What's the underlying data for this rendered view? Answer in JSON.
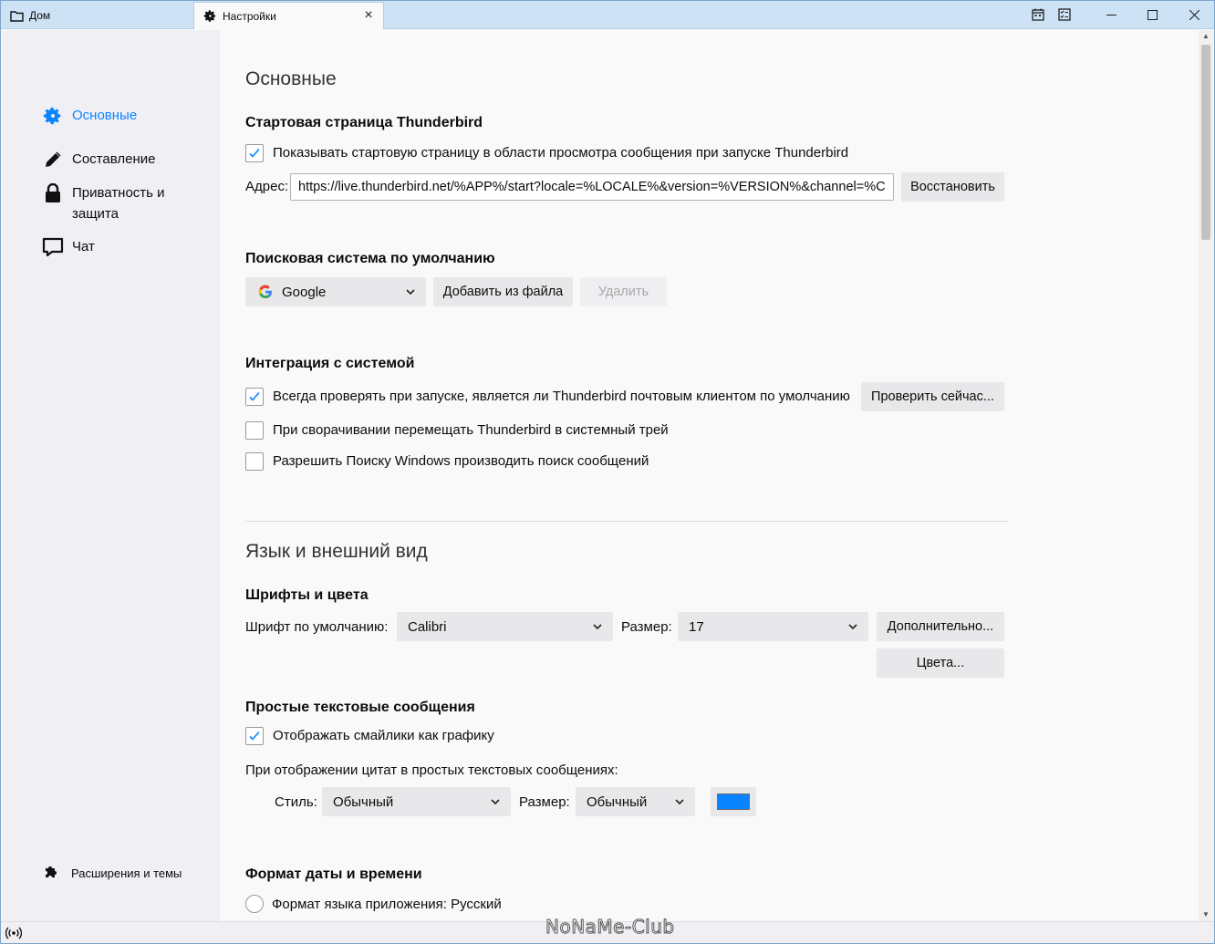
{
  "tabs": [
    {
      "label": "Дом"
    },
    {
      "label": "Настройки"
    }
  ],
  "sidebar": {
    "items": [
      {
        "label": "Основные"
      },
      {
        "label": "Составление"
      },
      {
        "label": "Приватность и защита"
      },
      {
        "label": "Чат"
      }
    ],
    "bottom_label": "Расширения и темы"
  },
  "general": {
    "title": "Основные",
    "start_page": {
      "heading": "Стартовая страница Thunderbird",
      "checkbox_label": "Показывать стартовую страницу в области просмотра сообщения при запуске Thunderbird",
      "checked": true,
      "address_label": "Адрес:",
      "address_value": "https://live.thunderbird.net/%APP%/start?locale=%LOCALE%&version=%VERSION%&channel=%C",
      "restore_label": "Восстановить"
    },
    "search": {
      "heading": "Поисковая система по умолчанию",
      "engine": "Google",
      "add_label": "Добавить из файла",
      "delete_label": "Удалить"
    },
    "integration": {
      "heading": "Интеграция с системой",
      "check_default_label": "Всегда проверять при запуске, является ли Thunderbird почтовым клиентом по умолчанию",
      "check_default_checked": true,
      "check_now_label": "Проверить сейчас...",
      "minimize_tray_label": "При сворачивании перемещать Thunderbird в системный трей",
      "minimize_tray_checked": false,
      "windows_search_label": "Разрешить Поиску Windows производить поиск сообщений",
      "windows_search_checked": false
    }
  },
  "language": {
    "title": "Язык и внешний вид",
    "fonts": {
      "heading": "Шрифты и цвета",
      "font_label": "Шрифт по умолчанию:",
      "font_value": "Calibri",
      "size_label": "Размер:",
      "size_value": "17",
      "advanced_label": "Дополнительно...",
      "colors_label": "Цвета..."
    },
    "plain_text": {
      "heading": "Простые текстовые сообщения",
      "emoticons_label": "Отображать смайлики как графику",
      "emoticons_checked": true,
      "quotes_label": "При отображении цитат в простых текстовых сообщениях:",
      "style_label": "Стиль:",
      "style_value": "Обычный",
      "size_label": "Размер:",
      "size_value": "Обычный",
      "quote_color": "#0a84ff"
    },
    "date_format": {
      "heading": "Формат даты и времени",
      "app_locale_label": "Формат языка приложения: Русский"
    }
  },
  "watermark": "NoNaMe-Club",
  "colors": {
    "accent": "#0a84ff",
    "titlebar": "#cde3f5"
  }
}
